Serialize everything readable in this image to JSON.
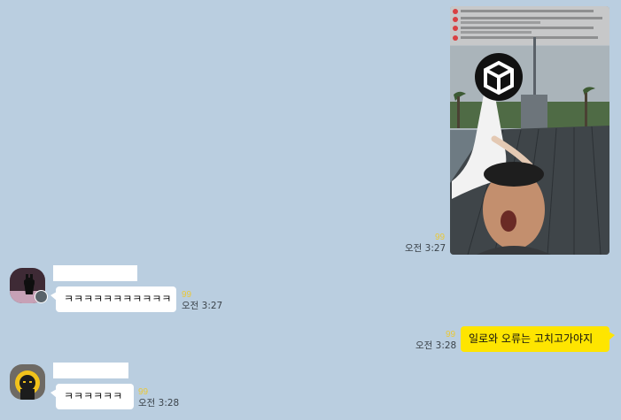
{
  "messages": [
    {
      "sender": "me",
      "type": "image",
      "unread": "99",
      "time": "오전 3:27"
    },
    {
      "sender": "friend-1",
      "type": "text",
      "text": "ㅋㅋㅋㅋㅋㅋㅋㅋㅋㅋㅋ",
      "unread": "99",
      "time": "오전 3:27"
    },
    {
      "sender": "me",
      "type": "text",
      "text": "일로와 오류는 고치고가야지",
      "unread": "99",
      "time": "오전 3:28"
    },
    {
      "sender": "friend-2",
      "type": "text",
      "text": "ㅋㅋㅋㅋㅋㅋ",
      "unread": "99",
      "time": "오전 3:28"
    }
  ],
  "colors": {
    "background": "#bacee0",
    "my_bubble": "#fee500",
    "friend_bubble": "#ffffff",
    "unread_count": "#e9c83a"
  },
  "icons": [
    "unity-logo-icon",
    "avatar-badge-icon"
  ]
}
